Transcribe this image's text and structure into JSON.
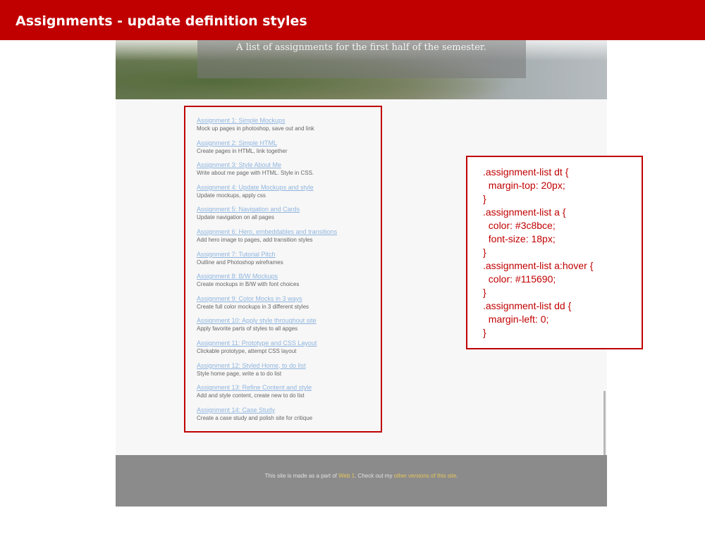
{
  "slide": {
    "title": "Assignments - update definition styles"
  },
  "hero": {
    "subtitle": "A list of assignments for the first half of the semester."
  },
  "assignments": [
    {
      "title": "Assignment 1: Simple Mockups",
      "desc": "Mock up pages in photoshop, save out and link"
    },
    {
      "title": "Assignment 2: Simple HTML",
      "desc": "Create pages in HTML, link together"
    },
    {
      "title": "Assignment 3: Style About Me",
      "desc": "Write about me page with HTML. Style in CSS."
    },
    {
      "title": "Assignment 4: Update Mockups and style",
      "desc": "Update mockups, apply css"
    },
    {
      "title": "Assignment 5: Navigation and Cards",
      "desc": "Update navigation on all pages"
    },
    {
      "title": "Assignment 6: Hero, embeddables and transitions",
      "desc": "Add hero image to pages, add transition styles"
    },
    {
      "title": "Assignment 7: Tutorial Pitch",
      "desc": "Outline and Photoshop wireframes"
    },
    {
      "title": "Assignment 8: B/W Mockups",
      "desc": "Create mockups in B/W with font choices"
    },
    {
      "title": "Assignment 9: Color Mocks in 3 ways",
      "desc": "Create full color mockups in 3 different styles"
    },
    {
      "title": "Assignment 10: Apply style throughout site",
      "desc": "Apply favorite parts of styles to all apges"
    },
    {
      "title": "Assignment 11: Prototype and CSS Layout",
      "desc": "Clickable prototype, attempt CSS layout"
    },
    {
      "title": "Assignment 12: Styled Home, to do list",
      "desc": "Style home page, write a to do list"
    },
    {
      "title": "Assignment 13: Refine Content and style",
      "desc": "Add and style content, create new to do list"
    },
    {
      "title": "Assignment 14: Case Study",
      "desc": "Create a case study and polish site for critique"
    }
  ],
  "footer": {
    "text_before": "This site is made as a part of ",
    "web1_link": "Web 1",
    "text_middle": ". Check out my ",
    "versions_link": "other versions of this site",
    "text_end": "."
  },
  "code": {
    "lines": [
      ".assignment-list dt {",
      "  margin-top: 20px;",
      "}",
      ".assignment-list a {",
      "  color: #3c8bce;",
      "  font-size: 18px;",
      "}",
      ".assignment-list a:hover {",
      "  color: #115690;",
      "}",
      ".assignment-list dd {",
      "  margin-left: 0;",
      "}"
    ]
  },
  "colors": {
    "header_red": "#c00000",
    "link_blue": "#8fb5df",
    "footer_link_gold": "#e8c65a"
  }
}
